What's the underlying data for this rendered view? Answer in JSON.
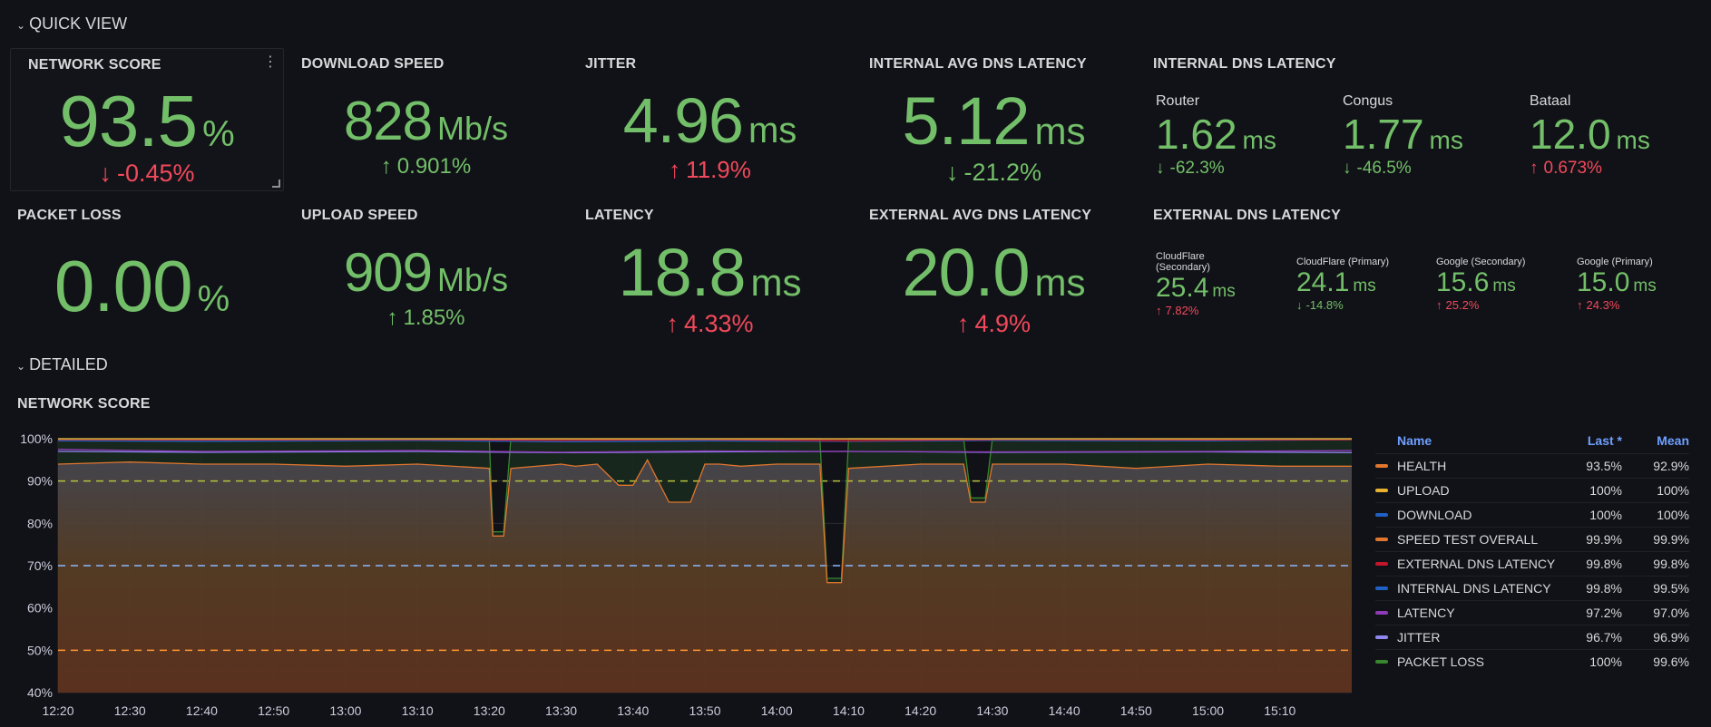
{
  "rows": {
    "quick_view": "QUICK VIEW",
    "detailed": "DETAILED"
  },
  "panels": {
    "network_score": {
      "title": "NETWORK SCORE",
      "value": "93.5",
      "unit": "%",
      "delta": "-0.45%",
      "arrow": "↓"
    },
    "download_speed": {
      "title": "DOWNLOAD SPEED",
      "value": "828",
      "unit": "Mb/s",
      "delta": "0.901%",
      "arrow": "↑"
    },
    "jitter": {
      "title": "JITTER",
      "value": "4.96",
      "unit": "ms",
      "delta": "11.9%",
      "arrow": "↑"
    },
    "internal_avg_dns": {
      "title": "INTERNAL AVG DNS LATENCY",
      "value": "5.12",
      "unit": "ms",
      "delta": "-21.2%",
      "arrow": "↓"
    },
    "packet_loss": {
      "title": "PACKET LOSS",
      "value": "0.00",
      "unit": "%"
    },
    "upload_speed": {
      "title": "UPLOAD SPEED",
      "value": "909",
      "unit": "Mb/s",
      "delta": "1.85%",
      "arrow": "↑"
    },
    "latency": {
      "title": "LATENCY",
      "value": "18.8",
      "unit": "ms",
      "delta": "4.33%",
      "arrow": "↑"
    },
    "external_avg_dns": {
      "title": "EXTERNAL AVG DNS LATENCY",
      "value": "20.0",
      "unit": "ms",
      "delta": "4.9%",
      "arrow": "↑"
    },
    "internal_dns": {
      "title": "INTERNAL DNS LATENCY",
      "items": [
        {
          "label": "Router",
          "value": "1.62",
          "unit": "ms",
          "delta": "-62.3%",
          "arrow": "↓"
        },
        {
          "label": "Congus",
          "value": "1.77",
          "unit": "ms",
          "delta": "-46.5%",
          "arrow": "↓"
        },
        {
          "label": "Bataal",
          "value": "12.0",
          "unit": "ms",
          "delta": "0.673%",
          "arrow": "↑"
        }
      ]
    },
    "external_dns": {
      "title": "EXTERNAL DNS LATENCY",
      "items": [
        {
          "label": "CloudFlare",
          "label2": "(Secondary)",
          "value": "25.4",
          "unit": "ms",
          "delta": "7.82%",
          "arrow": "↑"
        },
        {
          "label": "CloudFlare (Primary)",
          "value": "24.1",
          "unit": "ms",
          "delta": "-14.8%",
          "arrow": "↓"
        },
        {
          "label": "Google (Secondary)",
          "value": "15.6",
          "unit": "ms",
          "delta": "25.2%",
          "arrow": "↑"
        },
        {
          "label": "Google (Primary)",
          "value": "15.0",
          "unit": "ms",
          "delta": "24.3%",
          "arrow": "↑"
        }
      ]
    },
    "network_score_chart": {
      "title": "NETWORK SCORE"
    }
  },
  "icons": {
    "menu": "vertical-dots-icon",
    "collapse": "chevron-down-icon"
  },
  "colors": {
    "green": "#73bf69",
    "red": "#f2495c",
    "legend_header": "#6e9fff"
  },
  "legend": {
    "headers": {
      "name": "Name",
      "last": "Last *",
      "mean": "Mean"
    },
    "rows": [
      {
        "name": "HEALTH",
        "last": "93.5%",
        "mean": "92.9%",
        "color": "#e0752d"
      },
      {
        "name": "UPLOAD",
        "last": "100%",
        "mean": "100%",
        "color": "#e8b22e"
      },
      {
        "name": "DOWNLOAD",
        "last": "100%",
        "mean": "100%",
        "color": "#1f60c4"
      },
      {
        "name": "SPEED TEST OVERALL",
        "last": "99.9%",
        "mean": "99.9%",
        "color": "#e0752d"
      },
      {
        "name": "EXTERNAL DNS LATENCY",
        "last": "99.8%",
        "mean": "99.8%",
        "color": "#c4162a"
      },
      {
        "name": "INTERNAL DNS LATENCY",
        "last": "99.8%",
        "mean": "99.5%",
        "color": "#1f60c4"
      },
      {
        "name": "LATENCY",
        "last": "97.2%",
        "mean": "97.0%",
        "color": "#8f3bb8"
      },
      {
        "name": "JITTER",
        "last": "96.7%",
        "mean": "96.9%",
        "color": "#8f86f0"
      },
      {
        "name": "PACKET LOSS",
        "last": "100%",
        "mean": "99.6%",
        "color": "#37872d"
      }
    ]
  },
  "chart_data": {
    "type": "line",
    "title": "NETWORK SCORE",
    "ylim": [
      40,
      100
    ],
    "yticks": [
      "100%",
      "90%",
      "80%",
      "70%",
      "60%",
      "50%",
      "40%"
    ],
    "yvalues": [
      100,
      90,
      80,
      70,
      60,
      50,
      40
    ],
    "xticks": [
      "12:20",
      "12:30",
      "12:40",
      "12:50",
      "13:00",
      "13:10",
      "13:20",
      "13:30",
      "13:40",
      "13:50",
      "14:00",
      "14:10",
      "14:20",
      "14:30",
      "14:40",
      "14:50",
      "15:00",
      "15:10"
    ],
    "xlim_minutes": [
      740,
      920
    ],
    "thresholds": [
      {
        "value": 90,
        "color": "#b8c23c"
      },
      {
        "value": 70,
        "color": "#8ab8ff"
      },
      {
        "value": 50,
        "color": "#ff9830"
      }
    ],
    "grid": true,
    "legend_placement": "right",
    "series": [
      {
        "name": "HEALTH",
        "color": "#e0752d",
        "x": [
          740,
          750,
          760,
          770,
          780,
          790,
          800,
          800.5,
          802,
          803,
          810,
          812,
          815,
          818,
          820,
          822,
          825,
          828,
          830,
          832,
          835,
          840,
          846,
          847,
          849,
          850,
          860,
          862,
          866,
          867,
          869,
          870,
          880,
          890,
          900,
          910,
          920
        ],
        "values": [
          94,
          94.5,
          94,
          94,
          93.5,
          94,
          93,
          77,
          77,
          93,
          94,
          93.5,
          94,
          89,
          89,
          95,
          85,
          85,
          94,
          94,
          93.5,
          94,
          94,
          66,
          66,
          93,
          94,
          94,
          94,
          85,
          85,
          94,
          94,
          93,
          94,
          93.5,
          93.5
        ]
      },
      {
        "name": "UPLOAD",
        "color": "#e8b22e",
        "x": [
          740,
          920
        ],
        "values": [
          100,
          100
        ]
      },
      {
        "name": "DOWNLOAD",
        "color": "#1f60c4",
        "x": [
          740,
          920
        ],
        "values": [
          100,
          100
        ]
      },
      {
        "name": "SPEED TEST OVERALL",
        "color": "#e0752d",
        "x": [
          740,
          920
        ],
        "values": [
          99.9,
          99.9
        ]
      },
      {
        "name": "EXTERNAL DNS LATENCY",
        "color": "#c4162a",
        "x": [
          740,
          760,
          790,
          810,
          830,
          850,
          870,
          900,
          920
        ],
        "values": [
          99.8,
          99.7,
          99.8,
          99.6,
          99.8,
          99.5,
          99.8,
          99.7,
          99.8
        ]
      },
      {
        "name": "INTERNAL DNS LATENCY",
        "color": "#1f60c4",
        "x": [
          740,
          760,
          790,
          810,
          830,
          850,
          870,
          900,
          920
        ],
        "values": [
          99.5,
          99.4,
          99.6,
          99.3,
          99.5,
          99.4,
          99.6,
          99.5,
          99.8
        ]
      },
      {
        "name": "LATENCY",
        "color": "#8f3bb8",
        "x": [
          740,
          760,
          790,
          810,
          830,
          850,
          870,
          900,
          920
        ],
        "values": [
          97.5,
          97,
          97.2,
          96.8,
          97.1,
          97,
          96.9,
          97,
          97.2
        ]
      },
      {
        "name": "JITTER",
        "color": "#8f86f0",
        "x": [
          740,
          760,
          790,
          810,
          830,
          850,
          870,
          900,
          920
        ],
        "values": [
          97,
          96.8,
          97,
          96.7,
          96.9,
          97,
          96.8,
          96.9,
          96.7
        ]
      },
      {
        "name": "PACKET LOSS",
        "color": "#37872d",
        "x": [
          740,
          800,
          800.5,
          802,
          803,
          846,
          847,
          849,
          850,
          866,
          867,
          869,
          870,
          920
        ],
        "values": [
          100,
          100,
          78,
          78,
          100,
          100,
          67,
          67,
          100,
          100,
          86,
          86,
          100,
          100
        ]
      }
    ]
  }
}
